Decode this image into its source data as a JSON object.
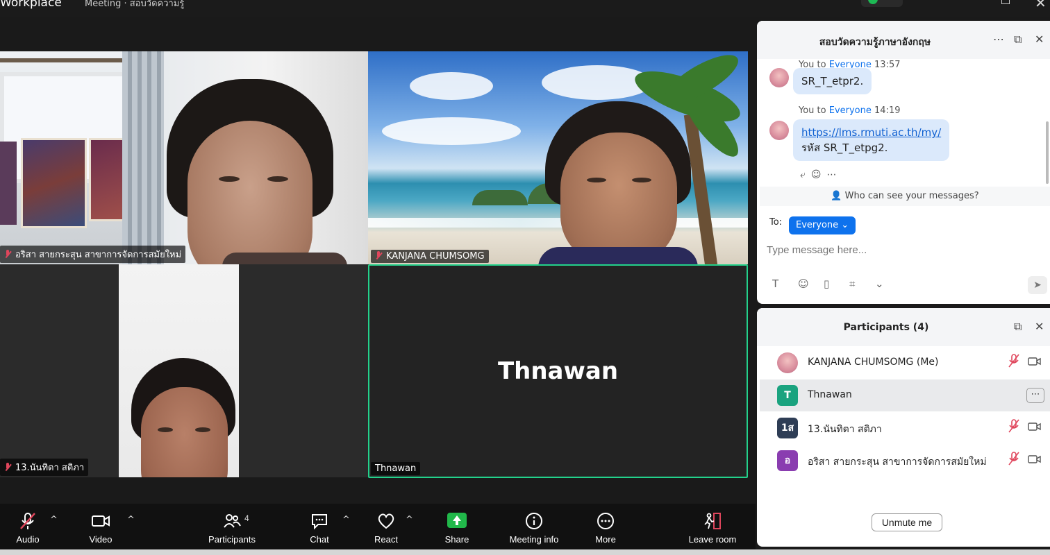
{
  "topbar": {
    "app_name": "Workplace",
    "meeting_label": "Meeting · สอบวัดความรู้"
  },
  "tiles": [
    {
      "name": "อริสา สายกระสุน สาขาการจัดการสมัยใหม่",
      "muted": true
    },
    {
      "name": "KANJANA CHUMSOMG",
      "muted": true
    },
    {
      "name": "13.นันทิตา สติภา",
      "muted": true
    },
    {
      "name": "Thnawan",
      "big_name": "Thnawan",
      "active_speaker": true
    }
  ],
  "toolbar": {
    "audio": "Audio",
    "video": "Video",
    "participants": "Participants",
    "participants_count": "4",
    "chat": "Chat",
    "react": "React",
    "share": "Share",
    "meeting_info": "Meeting info",
    "more": "More",
    "leave": "Leave room"
  },
  "chat": {
    "title": "สอบวัดความรู้ภาษาอังกฤษ",
    "messages": [
      {
        "sender": "You to",
        "recipient": "Everyone",
        "time": "13:57",
        "text": "SR_T_etpr2."
      },
      {
        "sender": "You to",
        "recipient": "Everyone",
        "time": "14:19",
        "link": "https://lms.rmuti.ac.th/my/",
        "text": "รหัส SR_T_etpg2."
      }
    ],
    "who_can_see": "Who can see your messages?",
    "to_label": "To:",
    "to_value": "Everyone",
    "input_placeholder": "Type message here..."
  },
  "participants": {
    "title": "Participants (4)",
    "list": [
      {
        "name": "KANJANA CHUMSOMG (Me)",
        "avatar": "",
        "avatar_color": "",
        "muted": true
      },
      {
        "name": "Thnawan",
        "avatar": "T",
        "avatar_color": "#1aa37f",
        "selected": true
      },
      {
        "name": "13.นันทิตา สติภา",
        "avatar": "1ส",
        "avatar_color": "#2e3d55",
        "muted": true
      },
      {
        "name": "อริสา สายกระสุน สาขาการจัดการสมัยใหม่",
        "avatar": "อ",
        "avatar_color": "#8a3db0",
        "muted": true
      }
    ],
    "unmute_me": "Unmute me"
  },
  "colors": {
    "accent": "#0e72ed",
    "active_speaker": "#23d18b",
    "muted": "#e0465c",
    "share": "#21b84a"
  }
}
